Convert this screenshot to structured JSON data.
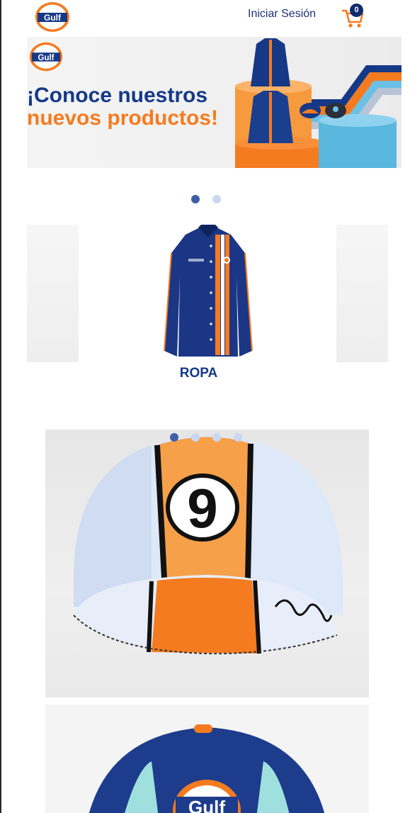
{
  "header": {
    "logo_text": "Gulf",
    "login_label": "Iniciar Sesión",
    "cart_count": "0"
  },
  "hero": {
    "logo_text": "Gulf",
    "title_line1": "¡Conoce nuestros",
    "title_line2": "nuevos productos!",
    "slides": 2,
    "active_slide": 1
  },
  "categories": {
    "current_label": "ROPA"
  },
  "product_gallery": {
    "slides": 4,
    "active_slide": 1,
    "cap_number": "9",
    "card2_logo_text": "Gulf"
  },
  "colors": {
    "navy": "#163987",
    "orange": "#f47b20",
    "light_blue": "#6cc0e5",
    "dot_active": "#3f5ea8",
    "dot_inactive": "#c9d8f0"
  }
}
